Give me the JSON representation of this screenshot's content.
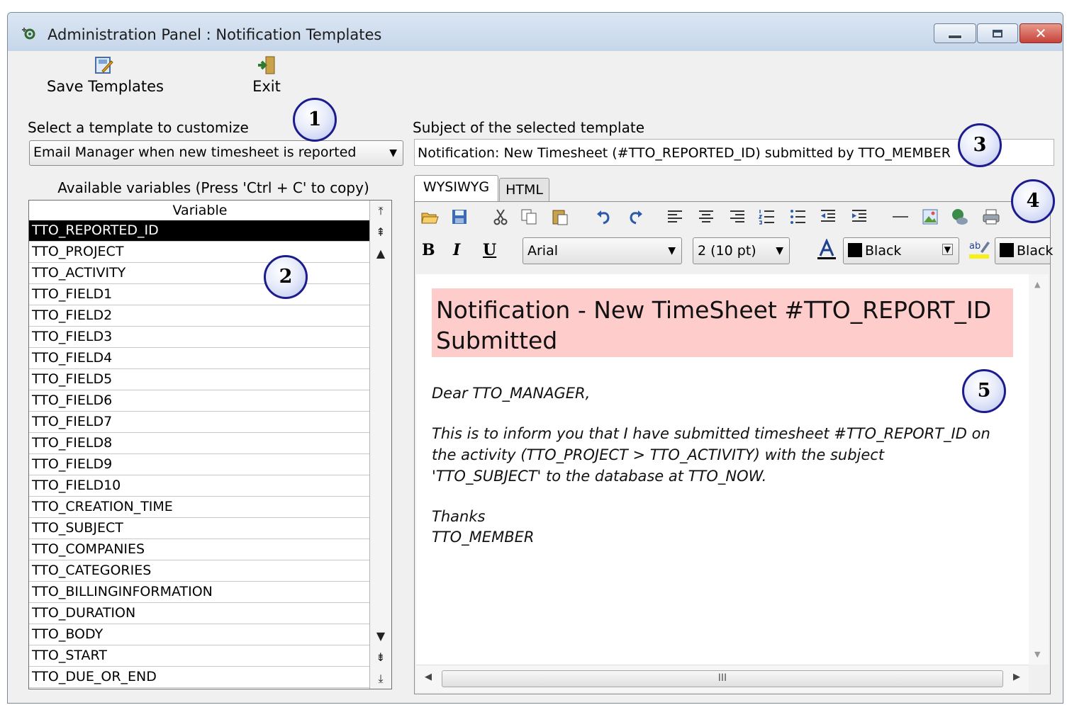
{
  "window": {
    "title": "Administration Panel : Notification Templates"
  },
  "toolbar": {
    "save_label": "Save Templates",
    "exit_label": "Exit"
  },
  "template_select": {
    "label": "Select a template to customize",
    "value": "Email Manager when new timesheet is reported"
  },
  "subject": {
    "label": "Subject of the selected template",
    "value": "Notification: New Timesheet (#TTO_REPORTED_ID) submitted by TTO_MEMBER"
  },
  "variables": {
    "caption": "Available variables (Press 'Ctrl + C' to copy)",
    "column_header": "Variable",
    "selected": "TTO_REPORTED_ID",
    "items": [
      "TTO_REPORTED_ID",
      "TTO_PROJECT",
      "TTO_ACTIVITY",
      "TTO_FIELD1",
      "TTO_FIELD2",
      "TTO_FIELD3",
      "TTO_FIELD4",
      "TTO_FIELD5",
      "TTO_FIELD6",
      "TTO_FIELD7",
      "TTO_FIELD8",
      "TTO_FIELD9",
      "TTO_FIELD10",
      "TTO_CREATION_TIME",
      "TTO_SUBJECT",
      "TTO_COMPANIES",
      "TTO_CATEGORIES",
      "TTO_BILLINGINFORMATION",
      "TTO_DURATION",
      "TTO_BODY",
      "TTO_START",
      "TTO_DUE_OR_END"
    ]
  },
  "editor": {
    "tabs": {
      "wysiwyg": "WYSIWYG",
      "html": "HTML"
    },
    "format": {
      "bold": "B",
      "italic": "I",
      "underline": "U"
    },
    "font": "Arial",
    "size": "2 (10 pt)",
    "font_color": "Black",
    "highlight_color": "Black",
    "scroll_grip": "III"
  },
  "message": {
    "heading": "Notification - New TimeSheet #TTO_REPORT_ID Submitted",
    "greeting": "Dear TTO_MANAGER,",
    "body_line1": "This is to inform you that I have submitted timesheet #TTO_REPORT_ID on",
    "body_line2": "the activity (TTO_PROJECT > TTO_ACTIVITY) with the subject",
    "body_line3": "'TTO_SUBJECT' to the database  at TTO_NOW.",
    "closing": "Thanks",
    "signature": "TTO_MEMBER"
  },
  "callouts": [
    "1",
    "2",
    "3",
    "4",
    "5"
  ],
  "colors": {
    "heading_bg": "#ffcccc",
    "callout_border": "#1c1c8c",
    "selected_row": "#000000"
  },
  "icons": [
    "app-gear-icon",
    "save-templates-icon",
    "exit-icon",
    "open-folder-icon",
    "save-disk-icon",
    "cut-icon",
    "copy-icon",
    "paste-icon",
    "undo-icon",
    "redo-icon",
    "align-left-icon",
    "align-center-icon",
    "align-right-icon",
    "numbered-list-icon",
    "bullet-list-icon",
    "outdent-icon",
    "indent-icon",
    "horizontal-rule-icon",
    "insert-image-icon",
    "insert-link-icon",
    "print-icon",
    "font-color-icon",
    "highlight-icon"
  ]
}
